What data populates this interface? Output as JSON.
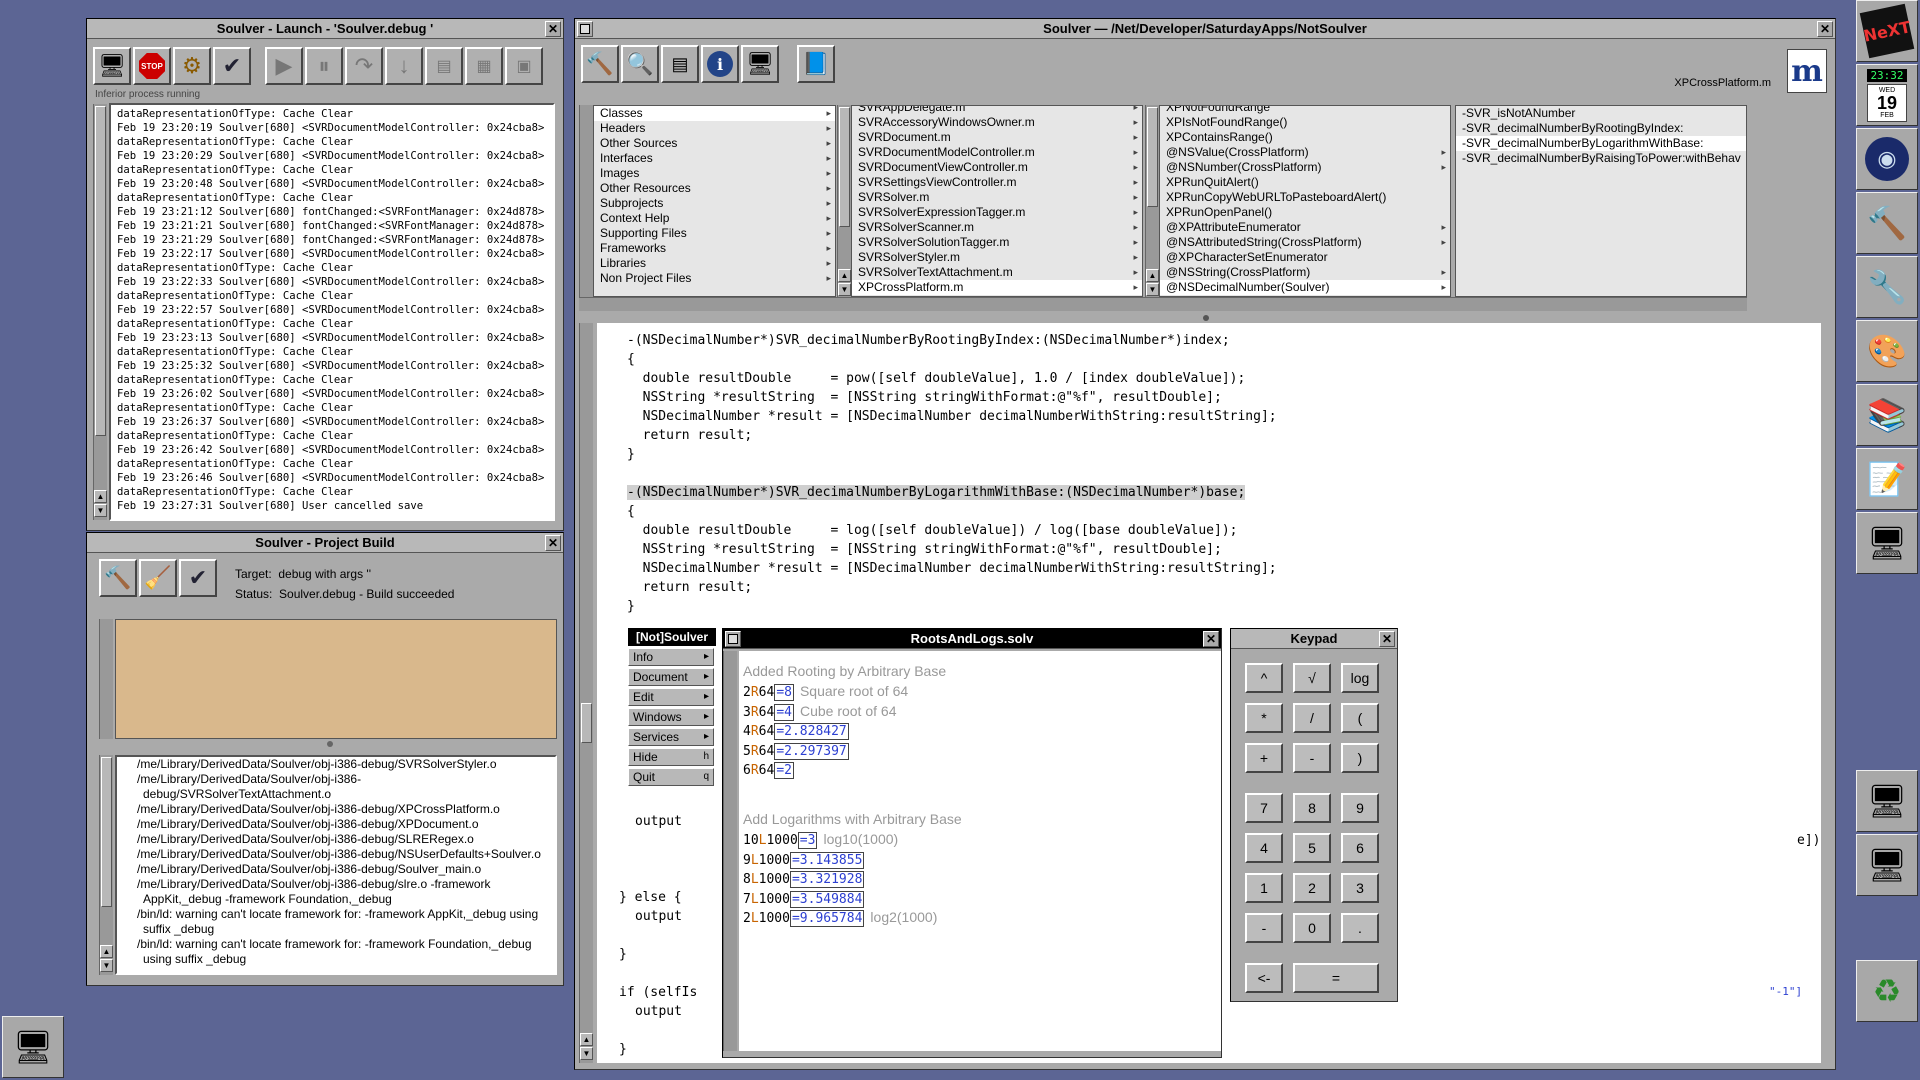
{
  "launch_window": {
    "title": "Soulver - Launch - 'Soulver.debug '",
    "status": "Inferior process running",
    "log_lines": [
      "dataRepresentationOfType: Cache Clear",
      "Feb 19 23:20:19 Soulver[680] <SVRDocumentModelController: 0x24cba8>",
      "dataRepresentationOfType: Cache Clear",
      "Feb 19 23:20:29 Soulver[680] <SVRDocumentModelController: 0x24cba8>",
      "dataRepresentationOfType: Cache Clear",
      "Feb 19 23:20:48 Soulver[680] <SVRDocumentModelController: 0x24cba8>",
      "dataRepresentationOfType: Cache Clear",
      "Feb 19 23:21:12 Soulver[680] fontChanged:<SVRFontManager: 0x24d878>",
      "Feb 19 23:21:21 Soulver[680] fontChanged:<SVRFontManager: 0x24d878>",
      "Feb 19 23:21:29 Soulver[680] fontChanged:<SVRFontManager: 0x24d878>",
      "Feb 19 23:22:17 Soulver[680] <SVRDocumentModelController: 0x24cba8>",
      "dataRepresentationOfType: Cache Clear",
      "Feb 19 23:22:33 Soulver[680] <SVRDocumentModelController: 0x24cba8>",
      "dataRepresentationOfType: Cache Clear",
      "Feb 19 23:22:57 Soulver[680] <SVRDocumentModelController: 0x24cba8>",
      "dataRepresentationOfType: Cache Clear",
      "Feb 19 23:23:13 Soulver[680] <SVRDocumentModelController: 0x24cba8>",
      "dataRepresentationOfType: Cache Clear",
      "Feb 19 23:25:32 Soulver[680] <SVRDocumentModelController: 0x24cba8>",
      "dataRepresentationOfType: Cache Clear",
      "Feb 19 23:26:02 Soulver[680] <SVRDocumentModelController: 0x24cba8>",
      "dataRepresentationOfType: Cache Clear",
      "Feb 19 23:26:37 Soulver[680] <SVRDocumentModelController: 0x24cba8>",
      "dataRepresentationOfType: Cache Clear",
      "Feb 19 23:26:42 Soulver[680] <SVRDocumentModelController: 0x24cba8>",
      "dataRepresentationOfType: Cache Clear",
      "Feb 19 23:26:46 Soulver[680] <SVRDocumentModelController: 0x24cba8>",
      "dataRepresentationOfType: Cache Clear",
      "Feb 19 23:27:31 Soulver[680] User cancelled save"
    ]
  },
  "build_window": {
    "title": "Soulver - Project Build",
    "target_label": "Target:",
    "target_value": "debug with args ''",
    "status_label": "Status:",
    "status_value": "Soulver.debug - Build succeeded",
    "output_lines": [
      "/me/Library/DerivedData/Soulver/obj-i386-debug/SVRSolverStyler.o",
      "/me/Library/DerivedData/Soulver/obj-i386-debug/SVRSolverTextAttachment.o",
      "/me/Library/DerivedData/Soulver/obj-i386-debug/XPCrossPlatform.o",
      "/me/Library/DerivedData/Soulver/obj-i386-debug/XPDocument.o",
      "/me/Library/DerivedData/Soulver/obj-i386-debug/SLRERegex.o",
      "/me/Library/DerivedData/Soulver/obj-i386-debug/NSUserDefaults+Soulver.o",
      "/me/Library/DerivedData/Soulver/obj-i386-debug/Soulver_main.o",
      "/me/Library/DerivedData/Soulver/obj-i386-debug/slre.o -framework AppKit,_debug -framework Foundation,_debug",
      "/bin/ld: warning can't locate framework for: -framework AppKit,_debug using suffix _debug",
      "/bin/ld: warning can't locate framework for: -framework Foundation,_debug using suffix _debug"
    ]
  },
  "project_window": {
    "title": "Soulver — /Net/Developer/SaturdayApps/NotSoulver",
    "file_label": "XPCrossPlatform.m",
    "col1": [
      "Classes",
      "Headers",
      "Other Sources",
      "Interfaces",
      "Images",
      "Other Resources",
      "Subprojects",
      "Context Help",
      "Supporting Files",
      "Frameworks",
      "Libraries",
      "Non Project Files"
    ],
    "col2": [
      "SVRAppDelegate.m",
      "SVRAccessoryWindowsOwner.m",
      "SVRDocument.m",
      "SVRDocumentModelController.m",
      "SVRDocumentViewController.m",
      "SVRSettingsViewController.m",
      "SVRSolver.m",
      "SVRSolverExpressionTagger.m",
      "SVRSolverScanner.m",
      "SVRSolverSolutionTagger.m",
      "SVRSolverStyler.m",
      "SVRSolverTextAttachment.m",
      "XPCrossPlatform.m"
    ],
    "col3": [
      "XPNotFoundRange",
      "XPIsNotFoundRange()",
      "XPContainsRange()",
      "@NSValue(CrossPlatform)",
      "@NSNumber(CrossPlatform)",
      "XPRunQuitAlert()",
      "XPRunCopyWebURLToPasteboardAlert()",
      "XPRunOpenPanel()",
      "@XPAttributeEnumerator",
      "@NSAttributedString(CrossPlatform)",
      "@XPCharacterSetEnumerator",
      "@NSString(CrossPlatform)",
      "@NSDecimalNumber(Soulver)"
    ],
    "col4": [
      "-SVR_isNotANumber",
      "-SVR_decimalNumberByRootingByIndex:",
      "-SVR_decimalNumberByLogarithmWithBase:",
      "-SVR_decimalNumberByRaisingToPower:withBehav"
    ],
    "code": [
      "-(NSDecimalNumber*)SVR_decimalNumberByRootingByIndex:(NSDecimalNumber*)index;",
      "{",
      "  double resultDouble     = pow([self doubleValue], 1.0 / [index doubleValue]);",
      "  NSString *resultString  = [NSString stringWithFormat:@\"%f\", resultDouble];",
      "  NSDecimalNumber *result = [NSDecimalNumber decimalNumberWithString:resultString];",
      "  return result;",
      "}",
      "",
      "-(NSDecimalNumber*)SVR_decimalNumberByLogarithmWithBase:(NSDecimalNumber*)base;",
      "{",
      "  double resultDouble     = log([self doubleValue]) / log([base doubleValue]);",
      "  NSString *resultString  = [NSString stringWithFormat:@\"%f\", resultDouble];",
      "  NSDecimalNumber *result = [NSDecimalNumber decimalNumberWithString:resultString];",
      "  return result;",
      "}"
    ],
    "code_fragments": {
      "output1": "output",
      "else_line": "} else {",
      "output2": "output",
      "close1": "}",
      "if_line": "if (selfIs",
      "output3": "output",
      "close2": "}",
      "right1": "e])",
      "right2": "\"-1\"]"
    }
  },
  "app_menu": {
    "title": "[Not]Soulver",
    "items": [
      {
        "label": "Info",
        "key": "▸"
      },
      {
        "label": "Document",
        "key": "▸"
      },
      {
        "label": "Edit",
        "key": "▸"
      },
      {
        "label": "Windows",
        "key": "▸"
      },
      {
        "label": "Services",
        "key": "▸"
      },
      {
        "label": "Hide",
        "key": "h"
      },
      {
        "label": "Quit",
        "key": "q"
      }
    ]
  },
  "doc_window": {
    "title": "RootsAndLogs.solv",
    "heading1": "Added Rooting by Arbitrary Base",
    "roots": [
      {
        "a": "2",
        "op": "R",
        "b": "64",
        "res": "=8",
        "note": "Square root of 64"
      },
      {
        "a": "3",
        "op": "R",
        "b": "64",
        "res": "=4",
        "note": "Cube root of 64"
      },
      {
        "a": "4",
        "op": "R",
        "b": "64",
        "res": "=2.828427",
        "note": ""
      },
      {
        "a": "5",
        "op": "R",
        "b": "64",
        "res": "=2.297397",
        "note": ""
      },
      {
        "a": "6",
        "op": "R",
        "b": "64",
        "res": "=2",
        "note": ""
      }
    ],
    "heading2": "Add Logarithms with Arbitrary Base",
    "logs": [
      {
        "a": "10",
        "op": "L",
        "b": "1000",
        "res": "=3",
        "note": "log10(1000)"
      },
      {
        "a": "9",
        "op": "L",
        "b": "1000",
        "res": "=3.143855",
        "note": ""
      },
      {
        "a": "8",
        "op": "L",
        "b": "1000",
        "res": "=3.321928",
        "note": ""
      },
      {
        "a": "7",
        "op": "L",
        "b": "1000",
        "res": "=3.549884",
        "note": ""
      },
      {
        "a": "2",
        "op": "L",
        "b": "1000",
        "res": "=9.965784",
        "note": "log2(1000)"
      }
    ]
  },
  "keypad": {
    "title": "Keypad",
    "rows": [
      [
        "^",
        "√",
        "log"
      ],
      [
        "*",
        "/",
        "("
      ],
      [
        "+",
        "-",
        ")"
      ],
      [
        "7",
        "8",
        "9"
      ],
      [
        "4",
        "5",
        "6"
      ],
      [
        "1",
        "2",
        "3"
      ],
      [
        "-",
        "0",
        "."
      ]
    ],
    "backspace": "<-",
    "equals": "="
  },
  "dock": {
    "clock": "23:32",
    "day": "WED",
    "date": "19",
    "month": "FEB"
  }
}
